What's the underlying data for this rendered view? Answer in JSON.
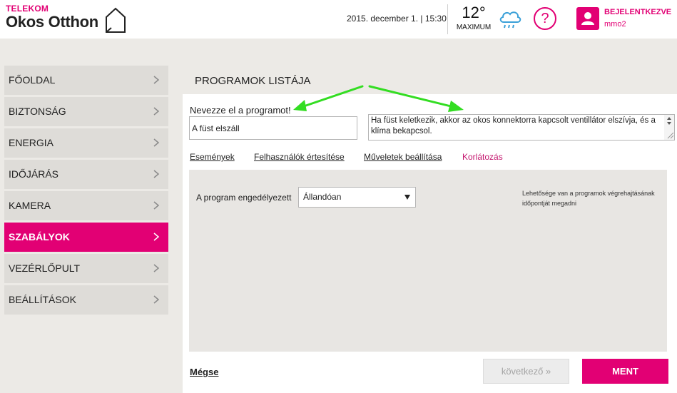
{
  "header": {
    "brand_top": "TELEKOM",
    "brand_main": "Okos Otthon",
    "datetime": "2015. december 1. | 15:30",
    "temperature": "12°",
    "temperature_label": "MAXIMUM",
    "help": "?",
    "login_label": "BEJELENTKEZVE",
    "username": "mmo2",
    "accent_color": "#e20074"
  },
  "sidebar": {
    "items": [
      {
        "label": "FŐOLDAL",
        "active": false
      },
      {
        "label": "BIZTONSÁG",
        "active": false
      },
      {
        "label": "ENERGIA",
        "active": false
      },
      {
        "label": "IDŐJÁRÁS",
        "active": false
      },
      {
        "label": "KAMERA",
        "active": false
      },
      {
        "label": "SZABÁLYOK",
        "active": true
      },
      {
        "label": "VEZÉRLŐPULT",
        "active": false
      },
      {
        "label": "BEÁLLÍTÁSOK",
        "active": false
      }
    ]
  },
  "main": {
    "title": "PROGRAMOK LISTÁJA",
    "name_label": "Nevezze el a programot!",
    "name_value": "A füst elszáll",
    "description": "Ha füst keletkezik, akkor az okos konnektorra kapcsolt ventillátor elszívja, és a klíma bekapcsol.",
    "tabs": [
      {
        "label": "Események",
        "active": false
      },
      {
        "label": "Felhasználók értesítése",
        "active": false
      },
      {
        "label": "Műveletek beállítása",
        "active": false
      },
      {
        "label": "Korlátozás",
        "active": true
      }
    ],
    "permission_label": "A program engedélyezett",
    "permission_value": "Állandóan",
    "hint": "Lehetősége van a programok végrehajtásának időpontját megadni",
    "cancel_label": "Mégse",
    "next_label": "következő »",
    "save_label": "MENT"
  }
}
